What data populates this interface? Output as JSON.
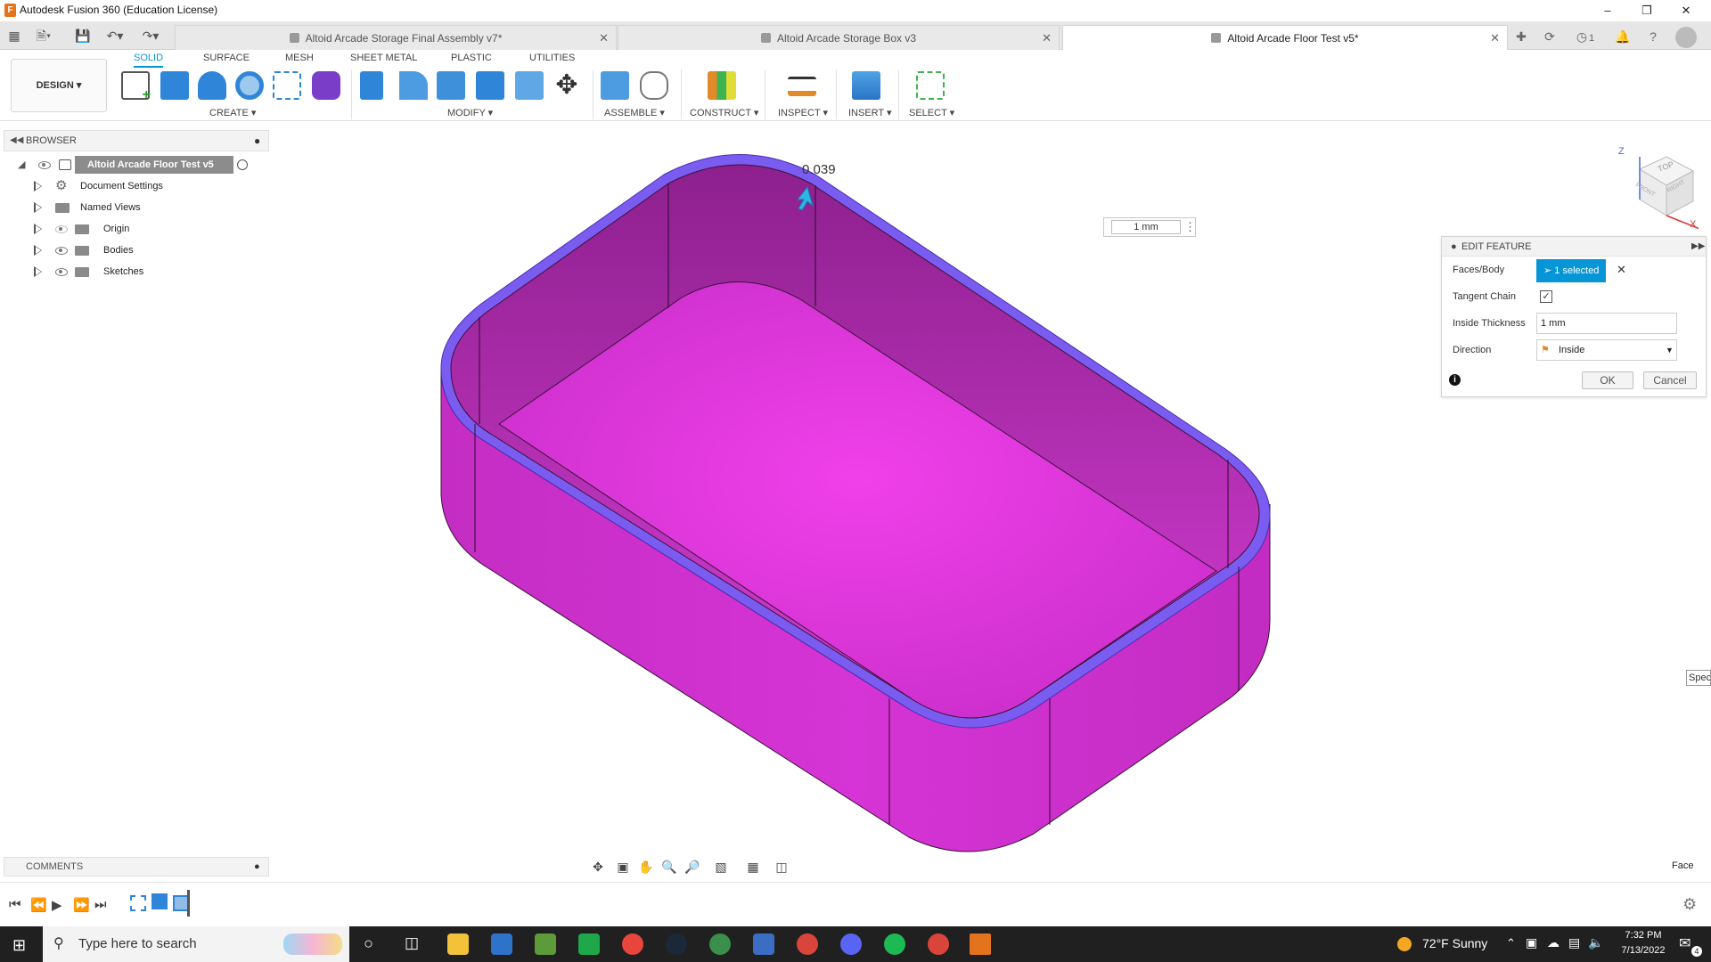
{
  "app": {
    "title": "Autodesk Fusion 360 (Education License)"
  },
  "tabs": [
    {
      "label": "Altoid Arcade Storage Final Assembly v7*",
      "active": false
    },
    {
      "label": "Altoid Arcade Storage Box v3",
      "active": false
    },
    {
      "label": "Altoid Arcade Floor Test v5*",
      "active": true
    }
  ],
  "header_right": {
    "jobs_count": "1"
  },
  "ribbon": {
    "workspace": "DESIGN",
    "tabs": [
      "SOLID",
      "SURFACE",
      "MESH",
      "SHEET METAL",
      "PLASTIC",
      "UTILITIES"
    ],
    "groups": [
      "CREATE",
      "MODIFY",
      "ASSEMBLE",
      "CONSTRUCT",
      "INSPECT",
      "INSERT",
      "SELECT"
    ]
  },
  "browser": {
    "title": "BROWSER",
    "root": "Altoid Arcade Floor Test v5",
    "items": [
      "Document Settings",
      "Named Views",
      "Origin",
      "Bodies",
      "Sketches"
    ]
  },
  "viewport": {
    "dimension_readout": "0.039",
    "thickness_box": "1 mm",
    "right_edge_label": "Spec",
    "status": "Face",
    "body_color": "#e034e0",
    "rim_color": "#7b5cf0"
  },
  "viewcube": {
    "top": "TOP",
    "front": "FRONT",
    "right": "RIGHT",
    "z": "Z",
    "x": "X"
  },
  "edit_feature": {
    "title": "EDIT FEATURE",
    "faces_label": "Faces/Body",
    "faces_value": "1 selected",
    "tangent_label": "Tangent Chain",
    "tangent_checked": true,
    "thickness_label": "Inside Thickness",
    "thickness_value": "1 mm",
    "direction_label": "Direction",
    "direction_value": "Inside",
    "ok": "OK",
    "cancel": "Cancel"
  },
  "comments": {
    "title": "COMMENTS"
  },
  "taskbar": {
    "search_placeholder": "Type here to search",
    "weather": "72°F  Sunny",
    "time": "7:32 PM",
    "date": "7/13/2022",
    "notifications": "4"
  },
  "colors": {
    "accent": "#0696d7",
    "brand": "#e3731c"
  }
}
